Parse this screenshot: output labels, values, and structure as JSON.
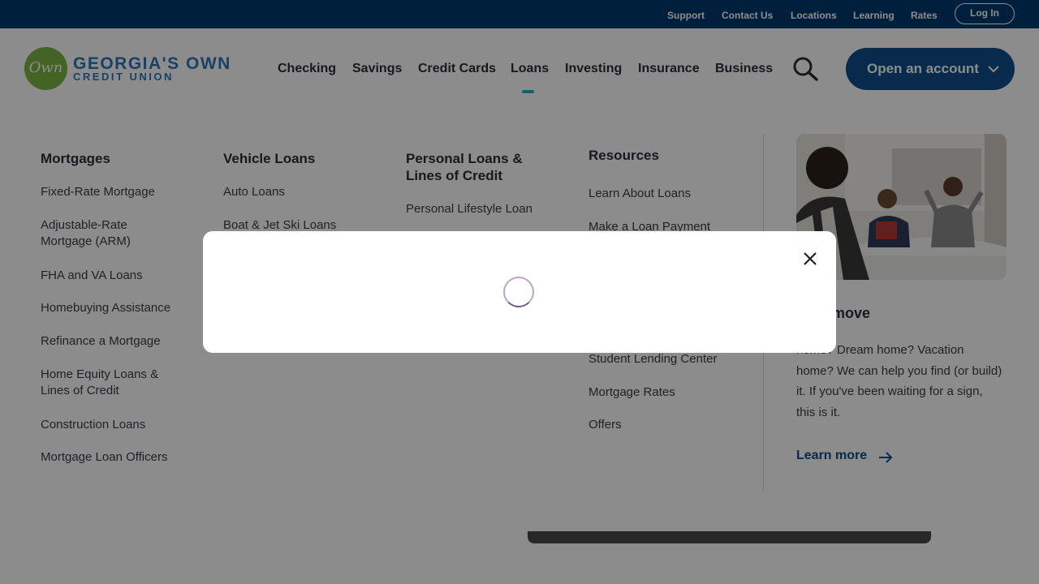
{
  "topbar": {
    "links": [
      "Support",
      "Contact Us",
      "Locations",
      "Learning",
      "Rates"
    ],
    "login_label": "Log In"
  },
  "brand": {
    "logo_mark": "Own",
    "name": "GEORGIA'S OWN",
    "sub": "CREDIT UNION",
    "green": "#7ab744",
    "blue": "#2a78b9"
  },
  "nav": {
    "items": [
      "Checking",
      "Savings",
      "Credit Cards",
      "Loans",
      "Investing",
      "Insurance",
      "Business"
    ],
    "active": "Loans",
    "search_icon": "search-icon",
    "open_account_label": "Open an account"
  },
  "mega_menu": {
    "mortgages": {
      "heading": "Mortgages",
      "links": [
        "Fixed-Rate Mortgage",
        "Adjustable-Rate Mortgage (ARM)",
        "FHA and VA Loans",
        "Homebuying Assistance",
        "Refinance a Mortgage",
        "Home Equity Loans & Lines of Credit",
        "Construction Loans",
        "Mortgage Loan Officers"
      ]
    },
    "vehicle": {
      "heading": "Vehicle Loans",
      "links": [
        "Auto Loans",
        "Boat & Jet Ski Loans"
      ]
    },
    "personal": {
      "heading": "Personal Loans & Lines of Credit",
      "links": [
        "Personal Lifestyle Loan"
      ]
    },
    "resources": {
      "heading": "Resources",
      "links": [
        "Learn About Loans",
        "Make a Loan Payment",
        "Student Lending Center",
        "Mortgage Rates",
        "Offers"
      ]
    },
    "promo": {
      "title": "your move",
      "text": "home? Dream home? Vacation home? We can help you find (or build) it. If you've been waiting for a sign, this is it.",
      "link_label": "Learn more"
    }
  },
  "modal": {
    "state": "loading",
    "close_icon": "close-icon"
  },
  "colors": {
    "topbar": "#003a70",
    "primary_button": "#0f4e8c",
    "active_indicator": "#35a7d7"
  }
}
